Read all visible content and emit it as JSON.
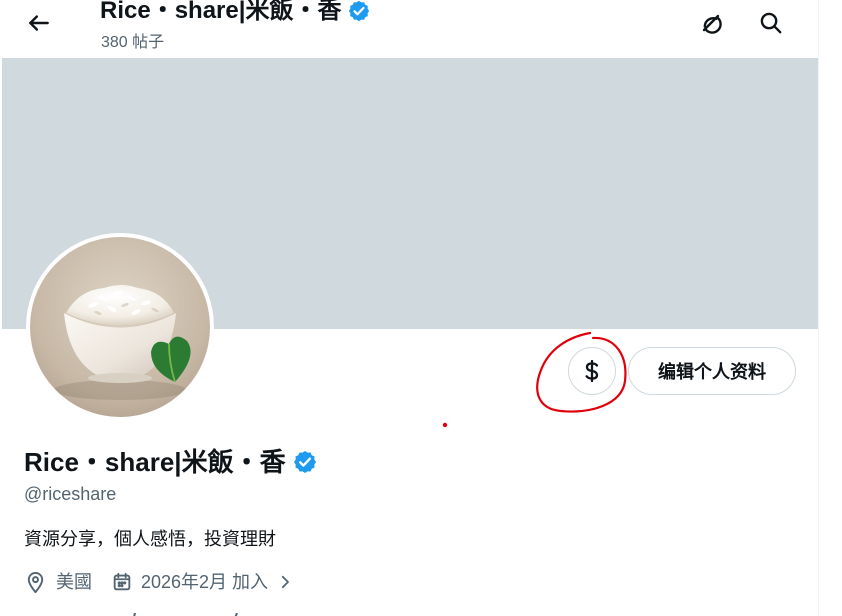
{
  "header": {
    "title": "Rice・share|米飯・香",
    "posts_count": "380 帖子",
    "icons": {
      "back": "arrow-left-icon",
      "verified": "verified-badge-icon",
      "grok": "grok-icon",
      "search": "search-icon"
    }
  },
  "profile": {
    "display_name": "Rice・share|米飯・香",
    "handle": "@riceshare",
    "bio": "資源分享，個人感悟，投資理財",
    "location": "美國",
    "join_date": "2026年2月 加入",
    "icons": {
      "location": "location-pin-icon",
      "calendar": "calendar-icon",
      "chevron": "chevron-right-icon",
      "subscribe": "dollar-sign-icon"
    }
  },
  "actions": {
    "edit_profile": "编辑个人资料"
  },
  "colors": {
    "banner": "#cfd9de",
    "verified": "#1d9bf0",
    "secondary_text": "#536471",
    "annotation": "#e0000a"
  }
}
